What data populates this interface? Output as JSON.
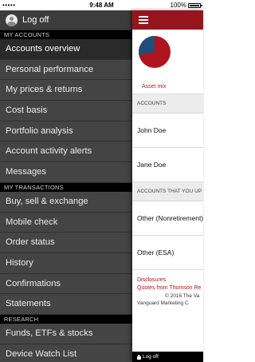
{
  "status_bar": {
    "carrier": "•••••",
    "wifi_icon": "wifi-icon",
    "time": "9:48 AM",
    "battery": "100%"
  },
  "sidebar": {
    "logoff_label": "Log off",
    "sections": [
      {
        "title": "MY ACCOUNTS",
        "items": [
          {
            "label": "Accounts overview",
            "active": true
          },
          {
            "label": "Personal performance"
          },
          {
            "label": "My prices & returns"
          },
          {
            "label": "Cost basis"
          },
          {
            "label": "Portfolio analysis"
          },
          {
            "label": "Account activity alerts"
          },
          {
            "label": "Messages"
          }
        ]
      },
      {
        "title": "MY TRANSACTIONS",
        "items": [
          {
            "label": "Buy, sell & exchange"
          },
          {
            "label": "Mobile check"
          },
          {
            "label": "Order status"
          },
          {
            "label": "History"
          },
          {
            "label": "Confirmations"
          },
          {
            "label": "Statements"
          }
        ]
      },
      {
        "title": "RESEARCH",
        "items": [
          {
            "label": "Funds, ETFs & stocks"
          },
          {
            "label": "Device Watch List"
          }
        ]
      }
    ]
  },
  "main": {
    "asset_mix_label": "Asset mix",
    "accounts_header": "ACCOUNTS",
    "accounts": [
      "John Doe",
      "Jane Doe"
    ],
    "accounts_you_header": "ACCOUNTS THAT YOU UP",
    "other_accounts": [
      "Other (Nonretirement)",
      "Other (ESA)"
    ],
    "links": [
      "Disclosures",
      "Quotes from Thomson Re"
    ],
    "copyright_line1": "© 2016 The Va",
    "copyright_line2": "Vanguard Marketing C",
    "bottom_logoff": "Log off"
  },
  "colors": {
    "brand_red": "#96151d",
    "pie_blue": "#1f4e79",
    "pie_red": "#b0141c"
  }
}
